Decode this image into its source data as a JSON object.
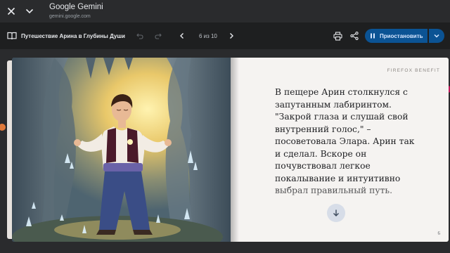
{
  "window": {
    "title": "Google Gemini",
    "url": "gemini.google.com",
    "close_icon": "close-icon",
    "minimize_icon": "chevron-down-icon"
  },
  "toolbar": {
    "story_title": "Путешествие Арина в Глубины Души",
    "pager": "6 из 10",
    "pause_label": "Приостановить",
    "icons": [
      "book-icon",
      "undo-icon",
      "redo-icon",
      "chevron-left-icon",
      "chevron-right-icon",
      "print-icon",
      "share-icon",
      "pause-icon",
      "chevron-down-icon"
    ],
    "accent": "#0b5394"
  },
  "page": {
    "brand": "FIREFOX BENEFIT",
    "text": "В пещере Арин столкнулся с запутанным лабиринтом. \"Закрой глаза и слушай свой внутренний голос,\" – посоветовала Элара. Арин так и сделал. Вскоре он почувствовал легкое покалывание и интуитивно выбрал правильный путь.",
    "number": "6",
    "illustration": "Young man with closed eyes standing in a glowing crystal cave",
    "scroll_icon": "arrow-down-icon"
  }
}
